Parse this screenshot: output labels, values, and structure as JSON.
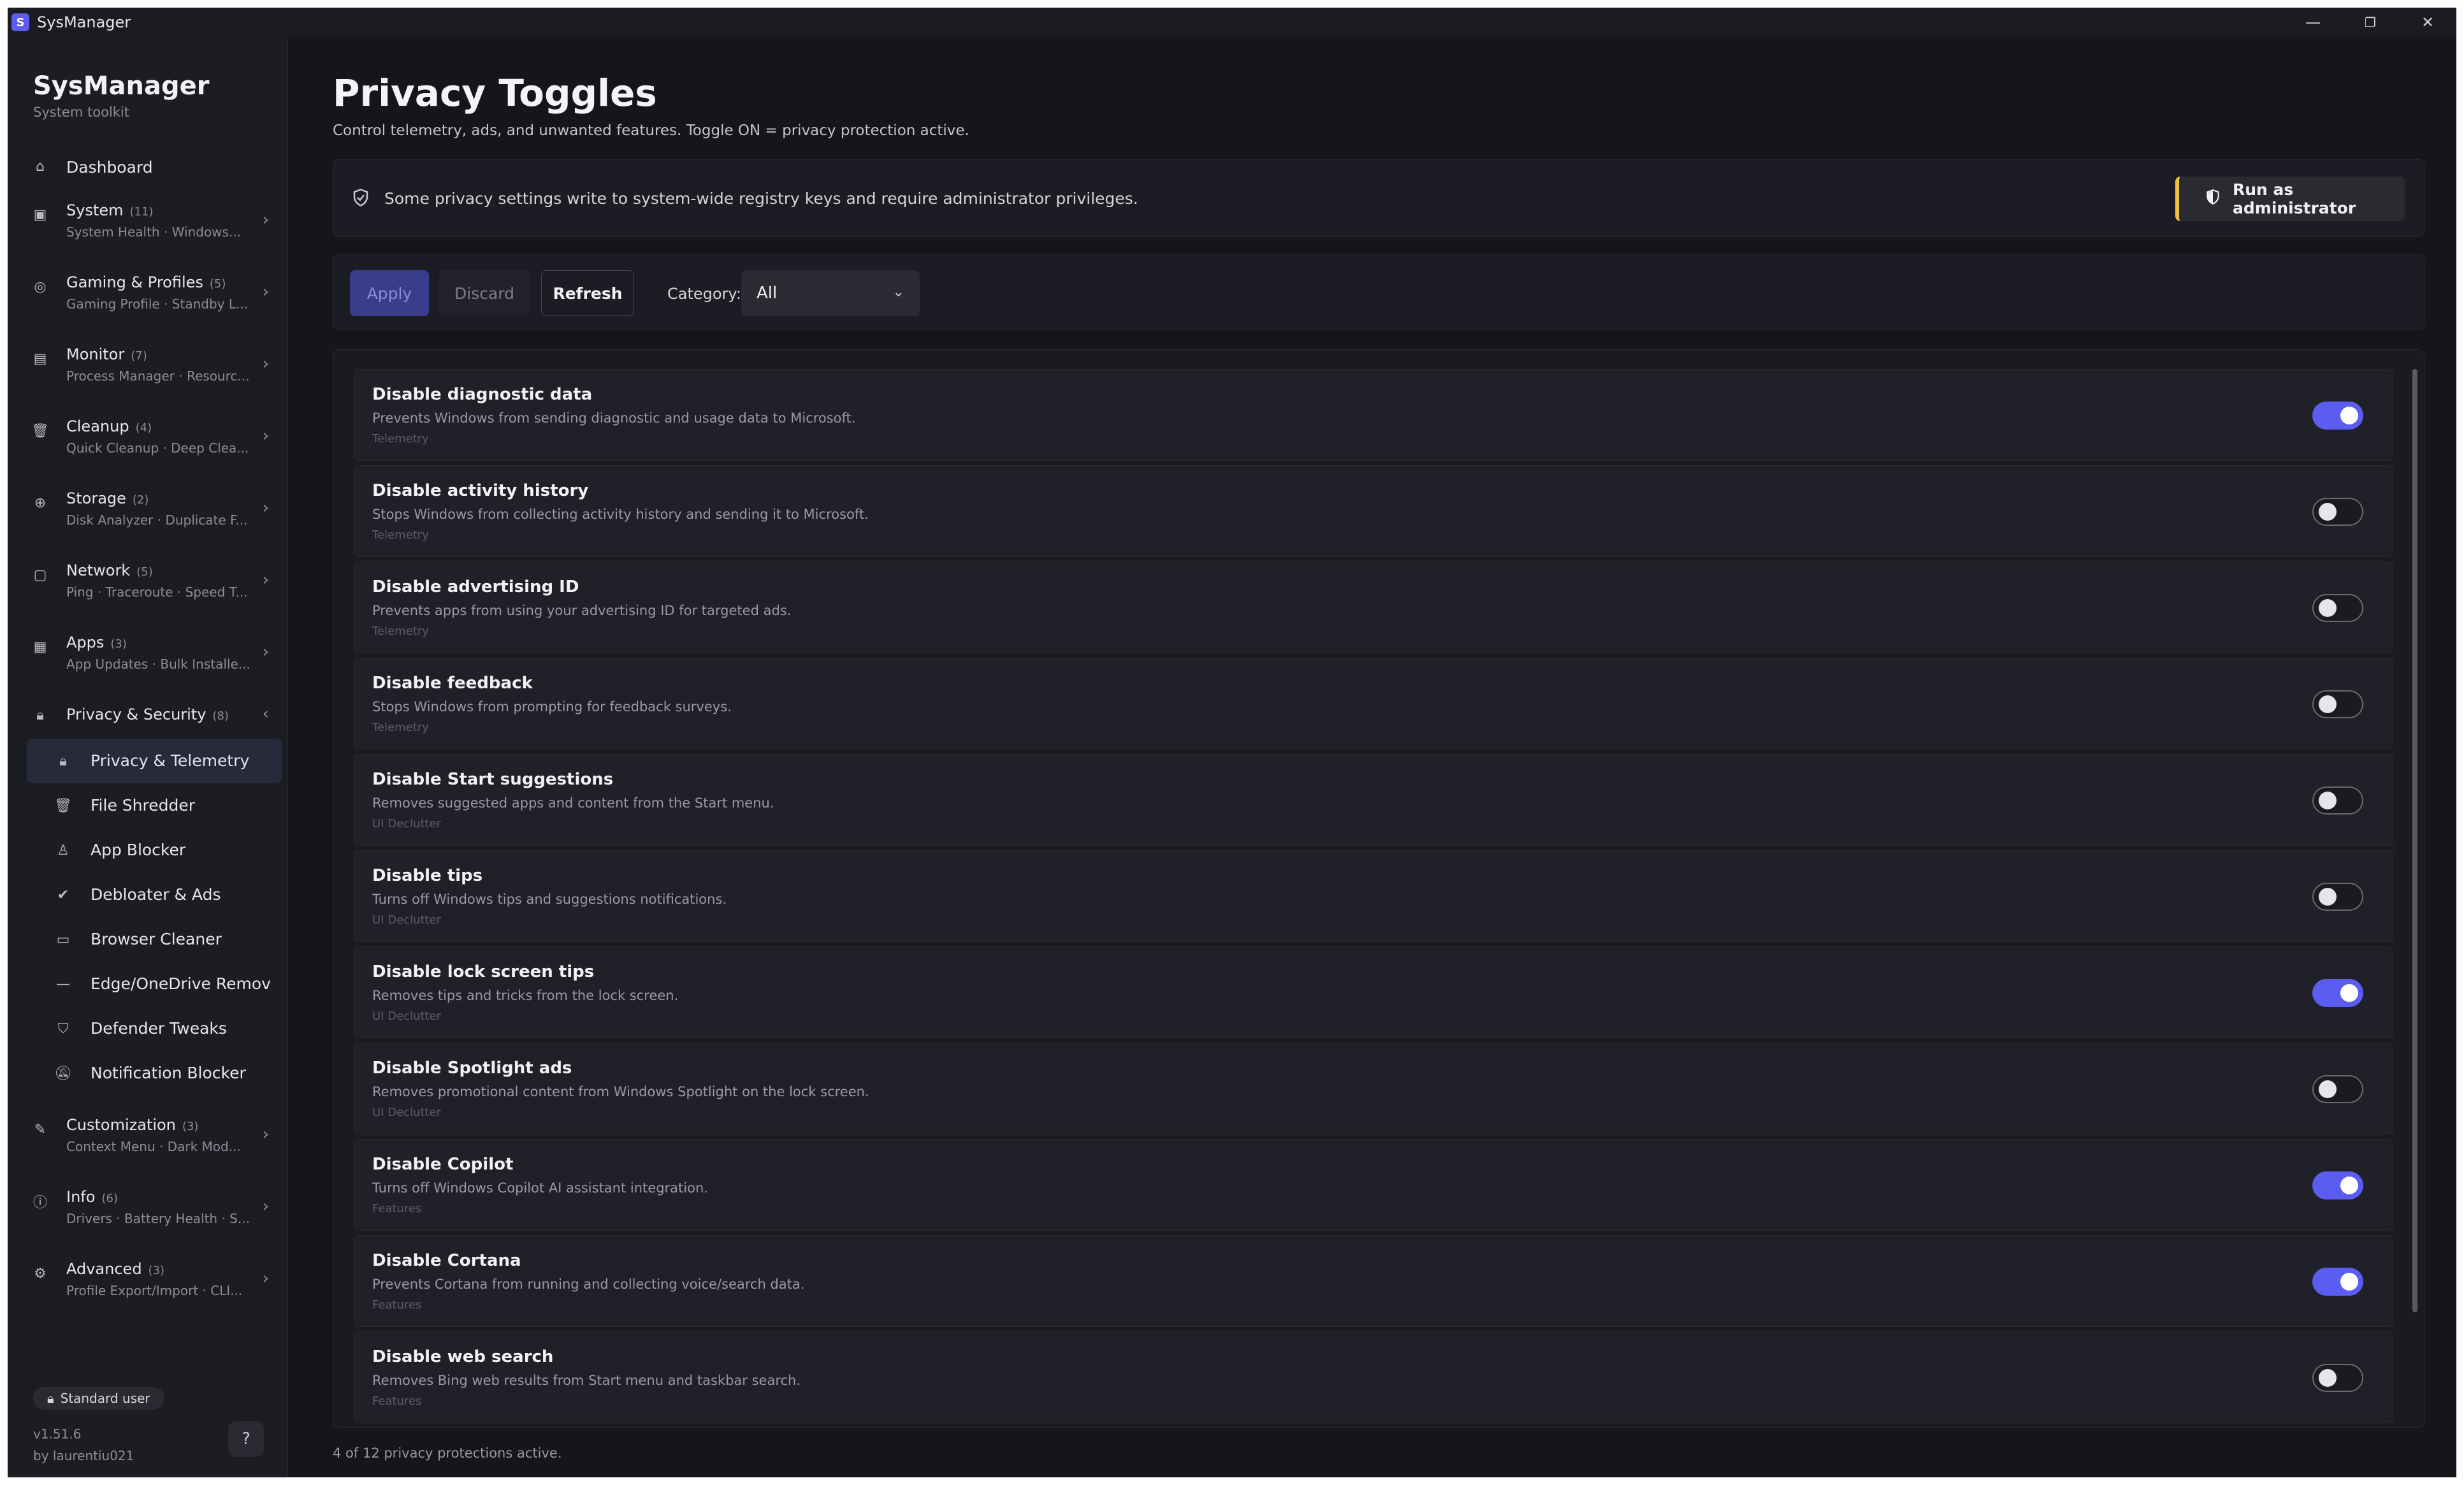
{
  "window": {
    "title": "SysManager",
    "app_icon_letter": "S",
    "minimize": "—",
    "restore": "❐",
    "close": "✕"
  },
  "sidebar": {
    "brand": "SysManager",
    "brand_sub": "System toolkit",
    "dashboard": "Dashboard",
    "groups": [
      {
        "label": "System",
        "count": "(11)",
        "sub": "System Health · Windows..."
      },
      {
        "label": "Gaming & Profiles",
        "count": "(5)",
        "sub": "Gaming Profile · Standby L..."
      },
      {
        "label": "Monitor",
        "count": "(7)",
        "sub": "Process Manager · Resourc..."
      },
      {
        "label": "Cleanup",
        "count": "(4)",
        "sub": "Quick Cleanup · Deep Clea..."
      },
      {
        "label": "Storage",
        "count": "(2)",
        "sub": "Disk Analyzer · Duplicate F..."
      },
      {
        "label": "Network",
        "count": "(5)",
        "sub": "Ping · Traceroute · Speed T..."
      },
      {
        "label": "Apps",
        "count": "(3)",
        "sub": "App Updates · Bulk Installe..."
      }
    ],
    "privacy_group": {
      "label": "Privacy & Security",
      "count": "(8)"
    },
    "privacy_items": [
      "Privacy & Telemetry",
      "File Shredder",
      "App Blocker",
      "Debloater & Ads",
      "Browser Cleaner",
      "Edge/OneDrive Remov",
      "Defender Tweaks",
      "Notification Blocker"
    ],
    "groups_after": [
      {
        "label": "Customization",
        "count": "(3)",
        "sub": "Context Menu · Dark Mod..."
      },
      {
        "label": "Info",
        "count": "(6)",
        "sub": "Drivers · Battery Health · S..."
      },
      {
        "label": "Advanced",
        "count": "(3)",
        "sub": "Profile Export/Import · CLI..."
      }
    ],
    "user_badge": "Standard user",
    "version": "v1.51.6",
    "author": "by laurentiu021"
  },
  "main": {
    "title": "Privacy Toggles",
    "description": "Control telemetry, ads, and unwanted features. Toggle ON = privacy protection active.",
    "banner_text": "Some privacy settings write to system-wide registry keys and require administrator privileges.",
    "admin_button": "Run as administrator",
    "toolbar": {
      "apply": "Apply",
      "discard": "Discard",
      "refresh": "Refresh",
      "category_label": "Category:",
      "category_value": "All"
    },
    "toggles": [
      {
        "title": "Disable diagnostic data",
        "desc": "Prevents Windows from sending diagnostic and usage data to Microsoft.",
        "category": "Telemetry",
        "on": true
      },
      {
        "title": "Disable activity history",
        "desc": "Stops Windows from collecting activity history and sending it to Microsoft.",
        "category": "Telemetry",
        "on": false
      },
      {
        "title": "Disable advertising ID",
        "desc": "Prevents apps from using your advertising ID for targeted ads.",
        "category": "Telemetry",
        "on": false
      },
      {
        "title": "Disable feedback",
        "desc": "Stops Windows from prompting for feedback surveys.",
        "category": "Telemetry",
        "on": false
      },
      {
        "title": "Disable Start suggestions",
        "desc": "Removes suggested apps and content from the Start menu.",
        "category": "UI Declutter",
        "on": false
      },
      {
        "title": "Disable tips",
        "desc": "Turns off Windows tips and suggestions notifications.",
        "category": "UI Declutter",
        "on": false
      },
      {
        "title": "Disable lock screen tips",
        "desc": "Removes tips and tricks from the lock screen.",
        "category": "UI Declutter",
        "on": true
      },
      {
        "title": "Disable Spotlight ads",
        "desc": "Removes promotional content from Windows Spotlight on the lock screen.",
        "category": "UI Declutter",
        "on": false
      },
      {
        "title": "Disable Copilot",
        "desc": "Turns off Windows Copilot AI assistant integration.",
        "category": "Features",
        "on": true
      },
      {
        "title": "Disable Cortana",
        "desc": "Prevents Cortana from running and collecting voice/search data.",
        "category": "Features",
        "on": true
      },
      {
        "title": "Disable web search",
        "desc": "Removes Bing web results from Start menu and taskbar search.",
        "category": "Features",
        "on": false
      }
    ],
    "footer": "4 of 12 privacy protections active."
  },
  "colors": {
    "accent": "#5b5cf0",
    "warning": "#f0c03a",
    "background": "#15151b"
  }
}
